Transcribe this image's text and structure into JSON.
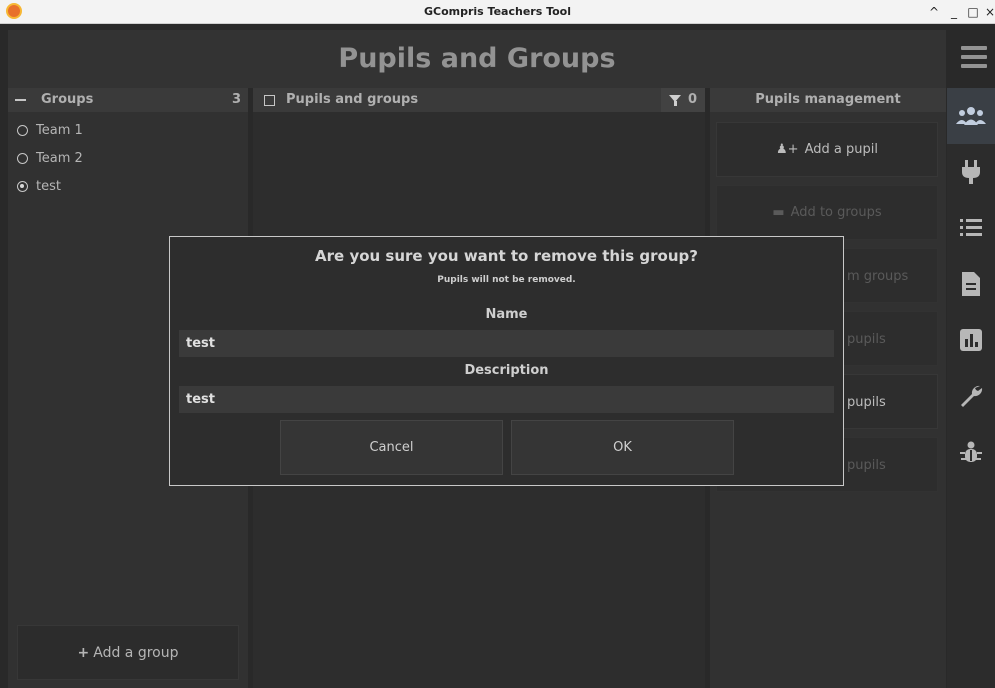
{
  "window": {
    "title": "GCompris Teachers Tool",
    "controls": {
      "collapse": "^",
      "minimize": "_",
      "maximize": "□",
      "close": "×"
    }
  },
  "header": {
    "title": "Pupils and Groups"
  },
  "groups_panel": {
    "title": "Groups",
    "count": "3",
    "items": [
      {
        "label": "Team 1",
        "selected": false
      },
      {
        "label": "Team 2",
        "selected": false
      },
      {
        "label": "test",
        "selected": true
      }
    ],
    "add_button": "Add a group"
  },
  "pupils_panel": {
    "title": "Pupils and groups",
    "filter_count": "0"
  },
  "management_panel": {
    "title": "Pupils management",
    "buttons": [
      {
        "label": "Add a pupil",
        "icon": "add-user-icon",
        "enabled": true
      },
      {
        "label": "Add to groups",
        "icon": "folder-icon",
        "enabled": false
      },
      {
        "label": "m groups",
        "enabled": false
      },
      {
        "label": "pupils",
        "enabled": false
      },
      {
        "label": "pupils",
        "enabled": true
      },
      {
        "label": "pupils",
        "enabled": false
      }
    ]
  },
  "rail": [
    "users-icon",
    "plug-icon",
    "list-icon",
    "document-icon",
    "chart-icon",
    "wrench-icon",
    "bug-icon"
  ],
  "dialog": {
    "question": "Are you sure you want to remove this group?",
    "subtitle": "Pupils will not be removed.",
    "name_label": "Name",
    "name_value": "test",
    "description_label": "Description",
    "description_value": "test",
    "cancel": "Cancel",
    "ok": "OK"
  }
}
